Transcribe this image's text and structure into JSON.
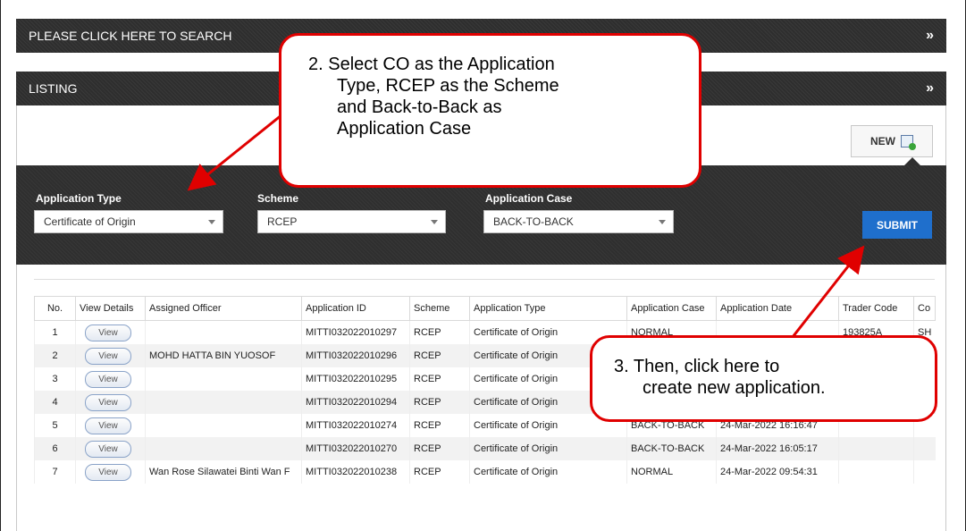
{
  "search_bar": {
    "label": "PLEASE CLICK HERE TO SEARCH",
    "icon": "double-chevron-down-icon"
  },
  "listing_bar": {
    "label": "LISTING",
    "icon": "double-chevron-down-icon"
  },
  "new_button": {
    "label": "NEW",
    "icon": "new-document-icon"
  },
  "filters": {
    "application_type": {
      "label": "Application Type",
      "value": "Certificate of Origin"
    },
    "scheme": {
      "label": "Scheme",
      "value": "RCEP"
    },
    "application_case": {
      "label": "Application Case",
      "value": "BACK-TO-BACK"
    },
    "submit_label": "SUBMIT"
  },
  "table": {
    "headers": [
      "No.",
      "View Details",
      "Assigned Officer",
      "Application ID",
      "Scheme",
      "Application Type",
      "Application Case",
      "Application Date",
      "Trader Code",
      "Co"
    ],
    "view_label": "View",
    "rows": [
      {
        "no": "1",
        "officer": "",
        "app_id": "MITTI032022010297",
        "scheme": "RCEP",
        "type": "Certificate of Origin",
        "case": "NORMAL",
        "date": "",
        "trader": "193825A",
        "co": "SH"
      },
      {
        "no": "2",
        "officer": "MOHD HATTA BIN YUOSOF",
        "app_id": "MITTI032022010296",
        "scheme": "RCEP",
        "type": "Certificate of Origin",
        "case": "",
        "date": "",
        "trader": "",
        "co": ""
      },
      {
        "no": "3",
        "officer": "",
        "app_id": "MITTI032022010295",
        "scheme": "RCEP",
        "type": "Certificate of Origin",
        "case": "",
        "date": "",
        "trader": "",
        "co": ""
      },
      {
        "no": "4",
        "officer": "",
        "app_id": "MITTI032022010294",
        "scheme": "RCEP",
        "type": "Certificate of Origin",
        "case": "",
        "date": "",
        "trader": "",
        "co": ""
      },
      {
        "no": "5",
        "officer": "",
        "app_id": "MITTI032022010274",
        "scheme": "RCEP",
        "type": "Certificate of Origin",
        "case": "BACK-TO-BACK",
        "date": "24-Mar-2022 16:16:47",
        "trader": "",
        "co": ""
      },
      {
        "no": "6",
        "officer": "",
        "app_id": "MITTI032022010270",
        "scheme": "RCEP",
        "type": "Certificate of Origin",
        "case": "BACK-TO-BACK",
        "date": "24-Mar-2022 16:05:17",
        "trader": "",
        "co": ""
      },
      {
        "no": "7",
        "officer": "Wan Rose Silawatei Binti Wan F",
        "app_id": "MITTI032022010238",
        "scheme": "RCEP",
        "type": "Certificate of Origin",
        "case": "NORMAL",
        "date": "24-Mar-2022 09:54:31",
        "trader": "",
        "co": ""
      }
    ]
  },
  "callouts": {
    "step2": {
      "line1": "2.  Select CO as the Application",
      "line2": "Type, RCEP as the Scheme",
      "line3": "and Back-to-Back as",
      "line4": "Application Case"
    },
    "step3": {
      "line1": "3.  Then, click here to",
      "line2": "create new application."
    }
  },
  "colors": {
    "callout_border": "#e00000",
    "submit": "#1f6fcc",
    "bar": "#2e2e2e"
  }
}
